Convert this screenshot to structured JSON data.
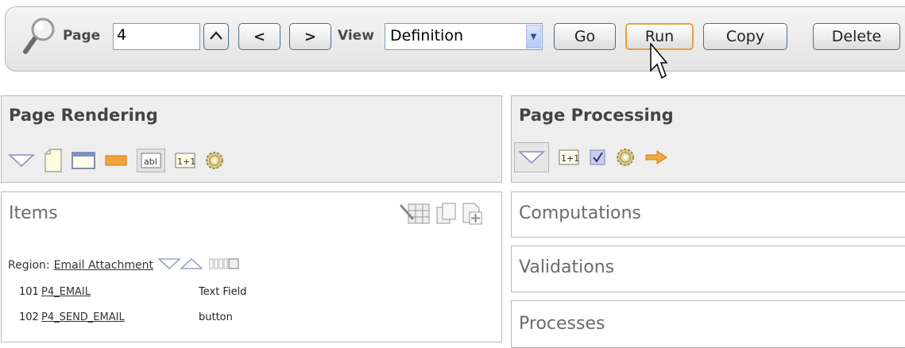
{
  "toolbar": {
    "page_label": "Page",
    "page_value": "4",
    "prev_glyph": "<",
    "next_glyph": ">",
    "view_label": "View",
    "view_value": "Definition",
    "go_label": "Go",
    "run_label": "Run",
    "copy_label": "Copy",
    "delete_label": "Delete"
  },
  "rendering": {
    "title": "Page Rendering",
    "icons": [
      "collapse-triangle-icon",
      "page-icon",
      "region-icon",
      "button-icon",
      "text-item-icon",
      "computation-icon",
      "gear-icon"
    ]
  },
  "processing": {
    "title": "Page Processing",
    "icons": [
      "collapse-triangle-icon",
      "computation-icon",
      "validation-icon",
      "gear-icon",
      "branch-arrow-icon"
    ]
  },
  "items": {
    "title": "Items",
    "region_label": "Region:",
    "region_link": "Email Attachment",
    "rows": [
      {
        "seq": "101",
        "name": "P4_EMAIL",
        "type": "Text Field"
      },
      {
        "seq": "102",
        "name": "P4_SEND_EMAIL",
        "type": "button"
      }
    ]
  },
  "sections": {
    "computations": "Computations",
    "validations": "Validations",
    "processes": "Processes"
  },
  "colors": {
    "panel_header_bg": "#eeeeee",
    "button_hover_border": "#e8a23a",
    "arrow_orange": "#f2a93b"
  }
}
